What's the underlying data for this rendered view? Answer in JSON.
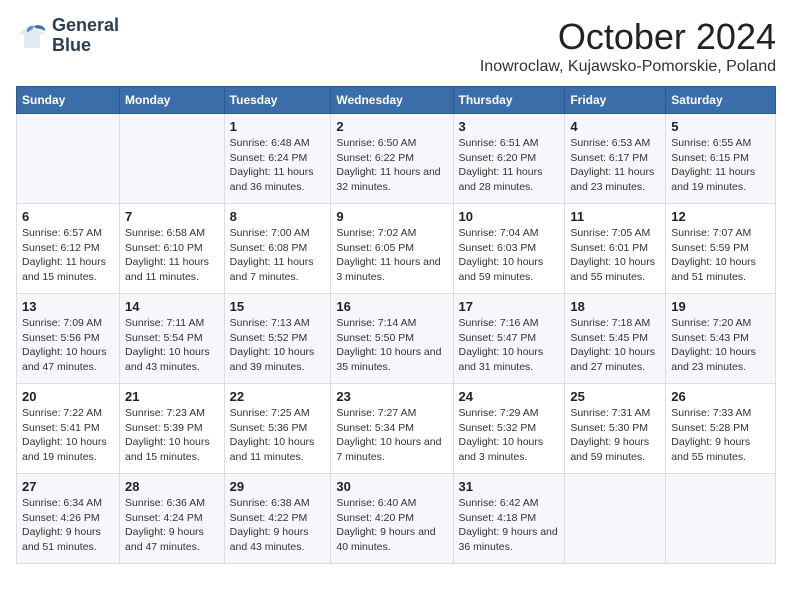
{
  "logo": {
    "line1": "General",
    "line2": "Blue"
  },
  "title": "October 2024",
  "location": "Inowroclaw, Kujawsko-Pomorskie, Poland",
  "headers": [
    "Sunday",
    "Monday",
    "Tuesday",
    "Wednesday",
    "Thursday",
    "Friday",
    "Saturday"
  ],
  "weeks": [
    [
      {
        "day": "",
        "info": ""
      },
      {
        "day": "",
        "info": ""
      },
      {
        "day": "1",
        "info": "Sunrise: 6:48 AM\nSunset: 6:24 PM\nDaylight: 11 hours and 36 minutes."
      },
      {
        "day": "2",
        "info": "Sunrise: 6:50 AM\nSunset: 6:22 PM\nDaylight: 11 hours and 32 minutes."
      },
      {
        "day": "3",
        "info": "Sunrise: 6:51 AM\nSunset: 6:20 PM\nDaylight: 11 hours and 28 minutes."
      },
      {
        "day": "4",
        "info": "Sunrise: 6:53 AM\nSunset: 6:17 PM\nDaylight: 11 hours and 23 minutes."
      },
      {
        "day": "5",
        "info": "Sunrise: 6:55 AM\nSunset: 6:15 PM\nDaylight: 11 hours and 19 minutes."
      }
    ],
    [
      {
        "day": "6",
        "info": "Sunrise: 6:57 AM\nSunset: 6:12 PM\nDaylight: 11 hours and 15 minutes."
      },
      {
        "day": "7",
        "info": "Sunrise: 6:58 AM\nSunset: 6:10 PM\nDaylight: 11 hours and 11 minutes."
      },
      {
        "day": "8",
        "info": "Sunrise: 7:00 AM\nSunset: 6:08 PM\nDaylight: 11 hours and 7 minutes."
      },
      {
        "day": "9",
        "info": "Sunrise: 7:02 AM\nSunset: 6:05 PM\nDaylight: 11 hours and 3 minutes."
      },
      {
        "day": "10",
        "info": "Sunrise: 7:04 AM\nSunset: 6:03 PM\nDaylight: 10 hours and 59 minutes."
      },
      {
        "day": "11",
        "info": "Sunrise: 7:05 AM\nSunset: 6:01 PM\nDaylight: 10 hours and 55 minutes."
      },
      {
        "day": "12",
        "info": "Sunrise: 7:07 AM\nSunset: 5:59 PM\nDaylight: 10 hours and 51 minutes."
      }
    ],
    [
      {
        "day": "13",
        "info": "Sunrise: 7:09 AM\nSunset: 5:56 PM\nDaylight: 10 hours and 47 minutes."
      },
      {
        "day": "14",
        "info": "Sunrise: 7:11 AM\nSunset: 5:54 PM\nDaylight: 10 hours and 43 minutes."
      },
      {
        "day": "15",
        "info": "Sunrise: 7:13 AM\nSunset: 5:52 PM\nDaylight: 10 hours and 39 minutes."
      },
      {
        "day": "16",
        "info": "Sunrise: 7:14 AM\nSunset: 5:50 PM\nDaylight: 10 hours and 35 minutes."
      },
      {
        "day": "17",
        "info": "Sunrise: 7:16 AM\nSunset: 5:47 PM\nDaylight: 10 hours and 31 minutes."
      },
      {
        "day": "18",
        "info": "Sunrise: 7:18 AM\nSunset: 5:45 PM\nDaylight: 10 hours and 27 minutes."
      },
      {
        "day": "19",
        "info": "Sunrise: 7:20 AM\nSunset: 5:43 PM\nDaylight: 10 hours and 23 minutes."
      }
    ],
    [
      {
        "day": "20",
        "info": "Sunrise: 7:22 AM\nSunset: 5:41 PM\nDaylight: 10 hours and 19 minutes."
      },
      {
        "day": "21",
        "info": "Sunrise: 7:23 AM\nSunset: 5:39 PM\nDaylight: 10 hours and 15 minutes."
      },
      {
        "day": "22",
        "info": "Sunrise: 7:25 AM\nSunset: 5:36 PM\nDaylight: 10 hours and 11 minutes."
      },
      {
        "day": "23",
        "info": "Sunrise: 7:27 AM\nSunset: 5:34 PM\nDaylight: 10 hours and 7 minutes."
      },
      {
        "day": "24",
        "info": "Sunrise: 7:29 AM\nSunset: 5:32 PM\nDaylight: 10 hours and 3 minutes."
      },
      {
        "day": "25",
        "info": "Sunrise: 7:31 AM\nSunset: 5:30 PM\nDaylight: 9 hours and 59 minutes."
      },
      {
        "day": "26",
        "info": "Sunrise: 7:33 AM\nSunset: 5:28 PM\nDaylight: 9 hours and 55 minutes."
      }
    ],
    [
      {
        "day": "27",
        "info": "Sunrise: 6:34 AM\nSunset: 4:26 PM\nDaylight: 9 hours and 51 minutes."
      },
      {
        "day": "28",
        "info": "Sunrise: 6:36 AM\nSunset: 4:24 PM\nDaylight: 9 hours and 47 minutes."
      },
      {
        "day": "29",
        "info": "Sunrise: 6:38 AM\nSunset: 4:22 PM\nDaylight: 9 hours and 43 minutes."
      },
      {
        "day": "30",
        "info": "Sunrise: 6:40 AM\nSunset: 4:20 PM\nDaylight: 9 hours and 40 minutes."
      },
      {
        "day": "31",
        "info": "Sunrise: 6:42 AM\nSunset: 4:18 PM\nDaylight: 9 hours and 36 minutes."
      },
      {
        "day": "",
        "info": ""
      },
      {
        "day": "",
        "info": ""
      }
    ]
  ]
}
